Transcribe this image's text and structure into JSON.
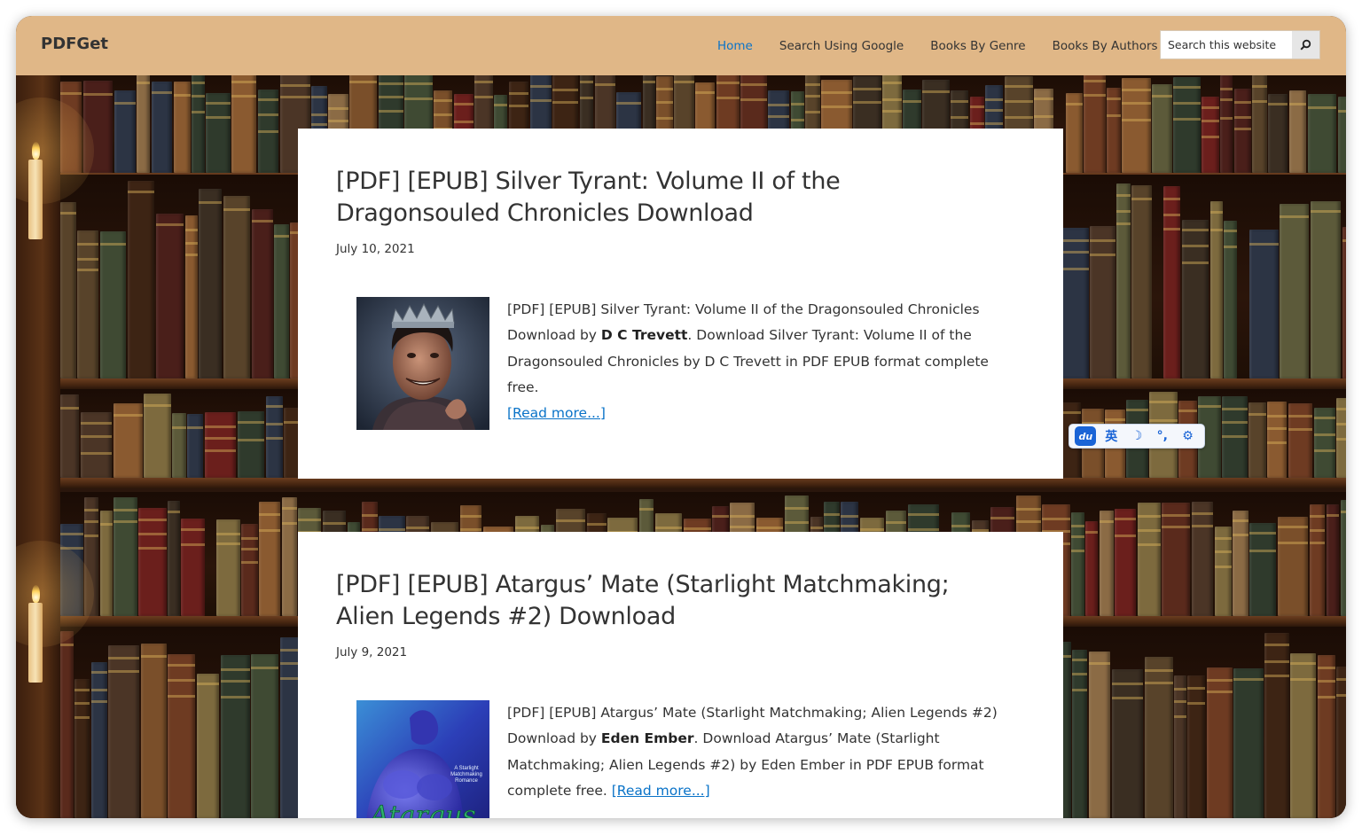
{
  "header": {
    "brand": "PDFGet",
    "nav": [
      {
        "label": "Home",
        "active": true
      },
      {
        "label": "Search Using Google",
        "active": false
      },
      {
        "label": "Books By Genre",
        "active": false
      },
      {
        "label": "Books By Authors",
        "active": false
      }
    ],
    "search": {
      "placeholder": "Search this website",
      "button_icon": "search-icon"
    }
  },
  "posts": [
    {
      "title": "[PDF] [EPUB] Silver Tyrant: Volume II of the Dragonsouled Chronicles Download",
      "date": "July 10, 2021",
      "excerpt_prefix": "[PDF] [EPUB] Silver Tyrant: Volume II of the Dragonsouled Chronicles Download by ",
      "author": "D C Trevett",
      "excerpt_suffix": ". Download Silver Tyrant: Volume II of the Dragonsouled Chronicles by D C Trevett in PDF EPUB format complete free. ",
      "read_more": "[Read more...]"
    },
    {
      "title": "[PDF] [EPUB] Atargus’ Mate (Starlight Matchmaking; Alien Legends #2) Download",
      "date": "July 9, 2021",
      "excerpt_prefix": "[PDF] [EPUB] Atargus’ Mate (Starlight Matchmaking; Alien Legends #2) Download by ",
      "author": "Eden Ember",
      "excerpt_suffix": ". Download Atargus’ Mate (Starlight Matchmaking; Alien Legends #2) by Eden Ember in PDF EPUB format complete free. ",
      "read_more": "[Read more...]",
      "cover_text": {
        "tagline": "A Starlight Matchmaking Romance",
        "title": "Atargus"
      }
    }
  ],
  "ime_toolbar": {
    "items": [
      {
        "icon": "du-logo-icon",
        "label": "du"
      },
      {
        "icon": "english-mode-icon",
        "label": "英"
      },
      {
        "icon": "moon-icon",
        "label": "☽"
      },
      {
        "icon": "punctuation-icon",
        "label": "°,"
      },
      {
        "icon": "settings-icon",
        "label": "⚙"
      }
    ]
  },
  "colors": {
    "header_bg": "#e0b787",
    "link": "#0a73c8",
    "text": "#333333",
    "ime_accent": "#1a64d6"
  }
}
